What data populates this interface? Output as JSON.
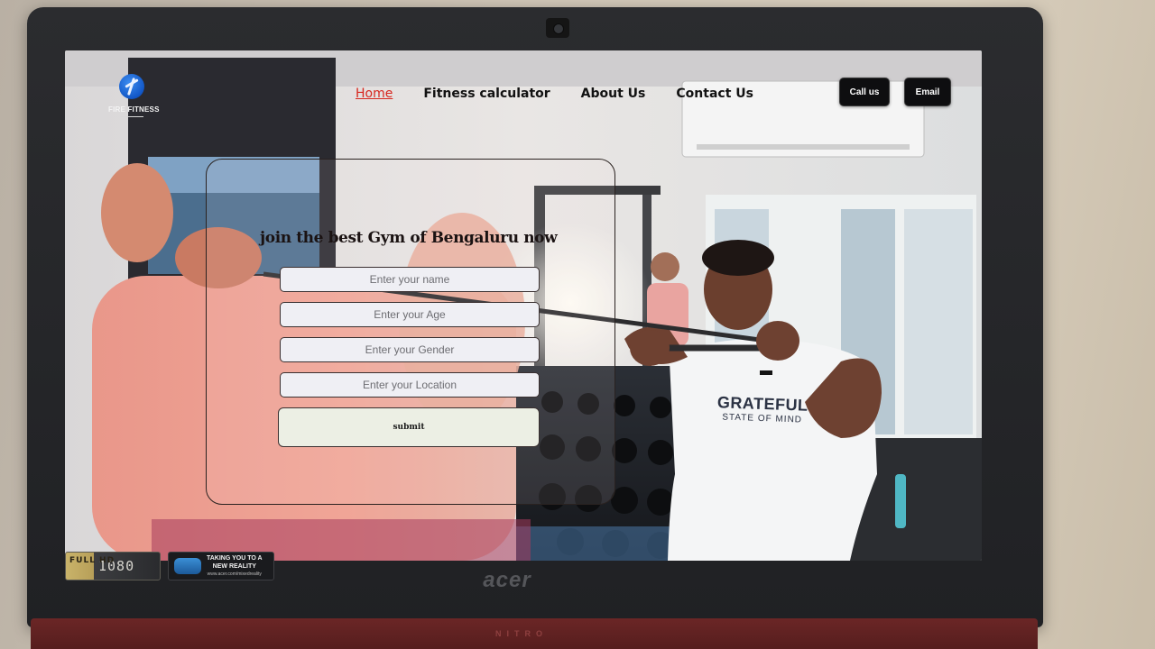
{
  "site": {
    "logo_text": "FIRE FITNESS",
    "nav": [
      {
        "label": "Home",
        "active": true
      },
      {
        "label": "Fitness calculator",
        "active": false
      },
      {
        "label": "About Us",
        "active": false
      },
      {
        "label": "Contact Us",
        "active": false
      }
    ],
    "header_buttons": {
      "call": "Call us",
      "email": "Email"
    },
    "form": {
      "title": "join the best Gym of Bengaluru now",
      "name_placeholder": "Enter your name",
      "age_placeholder": "Enter your Age",
      "gender_placeholder": "Enter your Gender",
      "location_placeholder": "Enter your Location",
      "submit_label": "submit"
    },
    "photo_shirt": {
      "line1": "GRATEFUL",
      "line2": "STATE OF MIND"
    },
    "accent_color": "#d7261e"
  },
  "device": {
    "brand": "acer",
    "base_label": "NITRO",
    "hd_sticker": {
      "small": "FULL HD",
      "main": "1080"
    },
    "mr_sticker": {
      "line1": "TAKING YOU TO A",
      "line2": "NEW REALITY",
      "url": "www.acer.com/mixedreality"
    }
  }
}
